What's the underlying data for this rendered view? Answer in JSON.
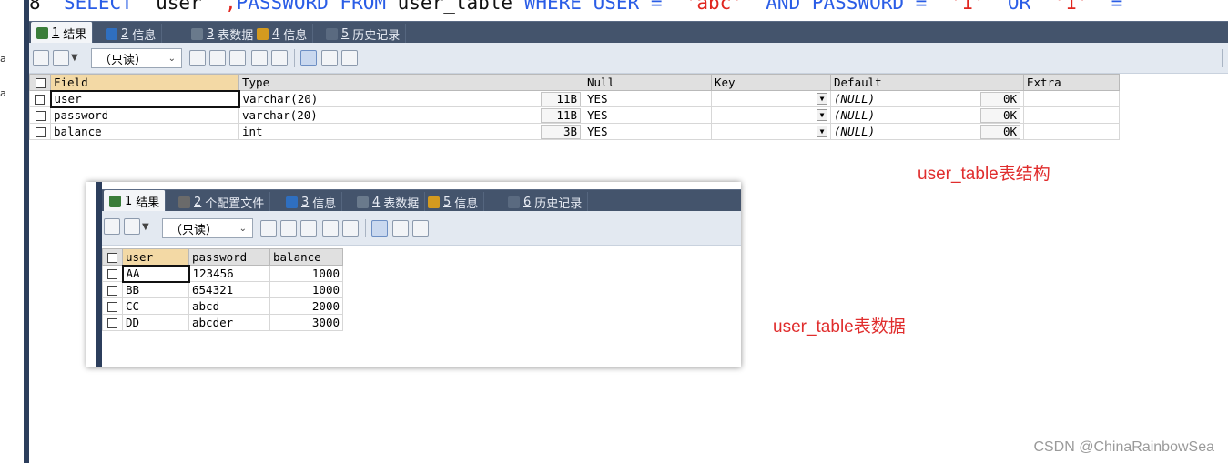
{
  "gutter_marks": [
    "a",
    "a"
  ],
  "sql": {
    "segments": [
      {
        "text": "8  ",
        "cls": "plain"
      },
      {
        "text": "SELECT",
        "cls": "kw"
      },
      {
        "text": "  user  ",
        "cls": "plain"
      },
      {
        "text": ",",
        "cls": "str"
      },
      {
        "text": "PASSWORD",
        "cls": "kw"
      },
      {
        "text": " ",
        "cls": "plain"
      },
      {
        "text": "FROM",
        "cls": "kw"
      },
      {
        "text": " user_table ",
        "cls": "plain"
      },
      {
        "text": "WHERE",
        "cls": "kw"
      },
      {
        "text": " ",
        "cls": "plain"
      },
      {
        "text": "USER",
        "cls": "kw"
      },
      {
        "text": " =  ",
        "cls": "kw"
      },
      {
        "text": "'abc'",
        "cls": "str"
      },
      {
        "text": "  ",
        "cls": "plain"
      },
      {
        "text": "AND",
        "cls": "kw"
      },
      {
        "text": " ",
        "cls": "plain"
      },
      {
        "text": "PASSWORD",
        "cls": "kw"
      },
      {
        "text": " =  ",
        "cls": "kw"
      },
      {
        "text": "'1'",
        "cls": "str"
      },
      {
        "text": "  ",
        "cls": "plain"
      },
      {
        "text": "OR",
        "cls": "kw"
      },
      {
        "text": "  ",
        "cls": "plain"
      },
      {
        "text": "'1'",
        "cls": "str"
      },
      {
        "text": "  =",
        "cls": "kw"
      }
    ]
  },
  "top_tabs": [
    {
      "num": "1",
      "label": "结果",
      "active": true,
      "icon": "result-grid-icon",
      "color": "#3a7d3a"
    },
    {
      "num": "2",
      "label": "信息",
      "active": false,
      "icon": "info-icon",
      "color": "#2f6fc0"
    },
    {
      "num": "3",
      "label": "表数据",
      "active": false,
      "icon": "table-data-icon",
      "color": "#6a7a8c"
    },
    {
      "num": "4",
      "label": "信息",
      "active": false,
      "icon": "info-blocks-icon",
      "color": "#d39a1f"
    },
    {
      "num": "5",
      "label": "历史记录",
      "active": false,
      "icon": "history-icon",
      "color": "#5a6a80"
    }
  ],
  "top_toolbar": {
    "readonly_label": "（只读）"
  },
  "structure_table": {
    "headers": [
      "Field",
      "Type",
      "Null",
      "Key",
      "Default",
      "Extra"
    ],
    "rows": [
      {
        "field": "user",
        "type": "varchar(20)",
        "size": "11B",
        "null": "YES",
        "key": "",
        "default": "(NULL)",
        "default_size": "0K",
        "extra": ""
      },
      {
        "field": "password",
        "type": "varchar(20)",
        "size": "11B",
        "null": "YES",
        "key": "",
        "default": "(NULL)",
        "default_size": "0K",
        "extra": ""
      },
      {
        "field": "balance",
        "type": "int",
        "size": "3B",
        "null": "YES",
        "key": "",
        "default": "(NULL)",
        "default_size": "0K",
        "extra": ""
      }
    ]
  },
  "inset_tabs": [
    {
      "num": "1",
      "label": "结果",
      "active": true,
      "icon": "result-grid-icon",
      "color": "#3a7d3a"
    },
    {
      "num": "2",
      "label": "个配置文件",
      "active": false,
      "icon": "profile-icon",
      "color": "#6a6a6a"
    },
    {
      "num": "3",
      "label": "信息",
      "active": false,
      "icon": "info-icon",
      "color": "#2f6fc0"
    },
    {
      "num": "4",
      "label": "表数据",
      "active": false,
      "icon": "table-data-icon",
      "color": "#6a7a8c"
    },
    {
      "num": "5",
      "label": "信息",
      "active": false,
      "icon": "info-blocks-icon",
      "color": "#d39a1f"
    },
    {
      "num": "6",
      "label": "历史记录",
      "active": false,
      "icon": "history-icon",
      "color": "#5a6a80"
    }
  ],
  "inset_toolbar": {
    "readonly_label": "（只读）"
  },
  "data_table": {
    "headers": [
      "user",
      "password",
      "balance"
    ],
    "rows": [
      {
        "user": "AA",
        "password": "123456",
        "balance": "1000"
      },
      {
        "user": "BB",
        "password": "654321",
        "balance": "1000"
      },
      {
        "user": "CC",
        "password": "abcd",
        "balance": "2000"
      },
      {
        "user": "DD",
        "password": "abcder",
        "balance": "3000"
      }
    ]
  },
  "annotations": {
    "structure": "user_table表结构",
    "data": "user_table表数据"
  },
  "watermark": "CSDN @ChinaRainbowSea",
  "colors": {
    "accent_red": "#e02d2d",
    "keyword_blue": "#2a5de6",
    "tabbar": "#44546c"
  }
}
